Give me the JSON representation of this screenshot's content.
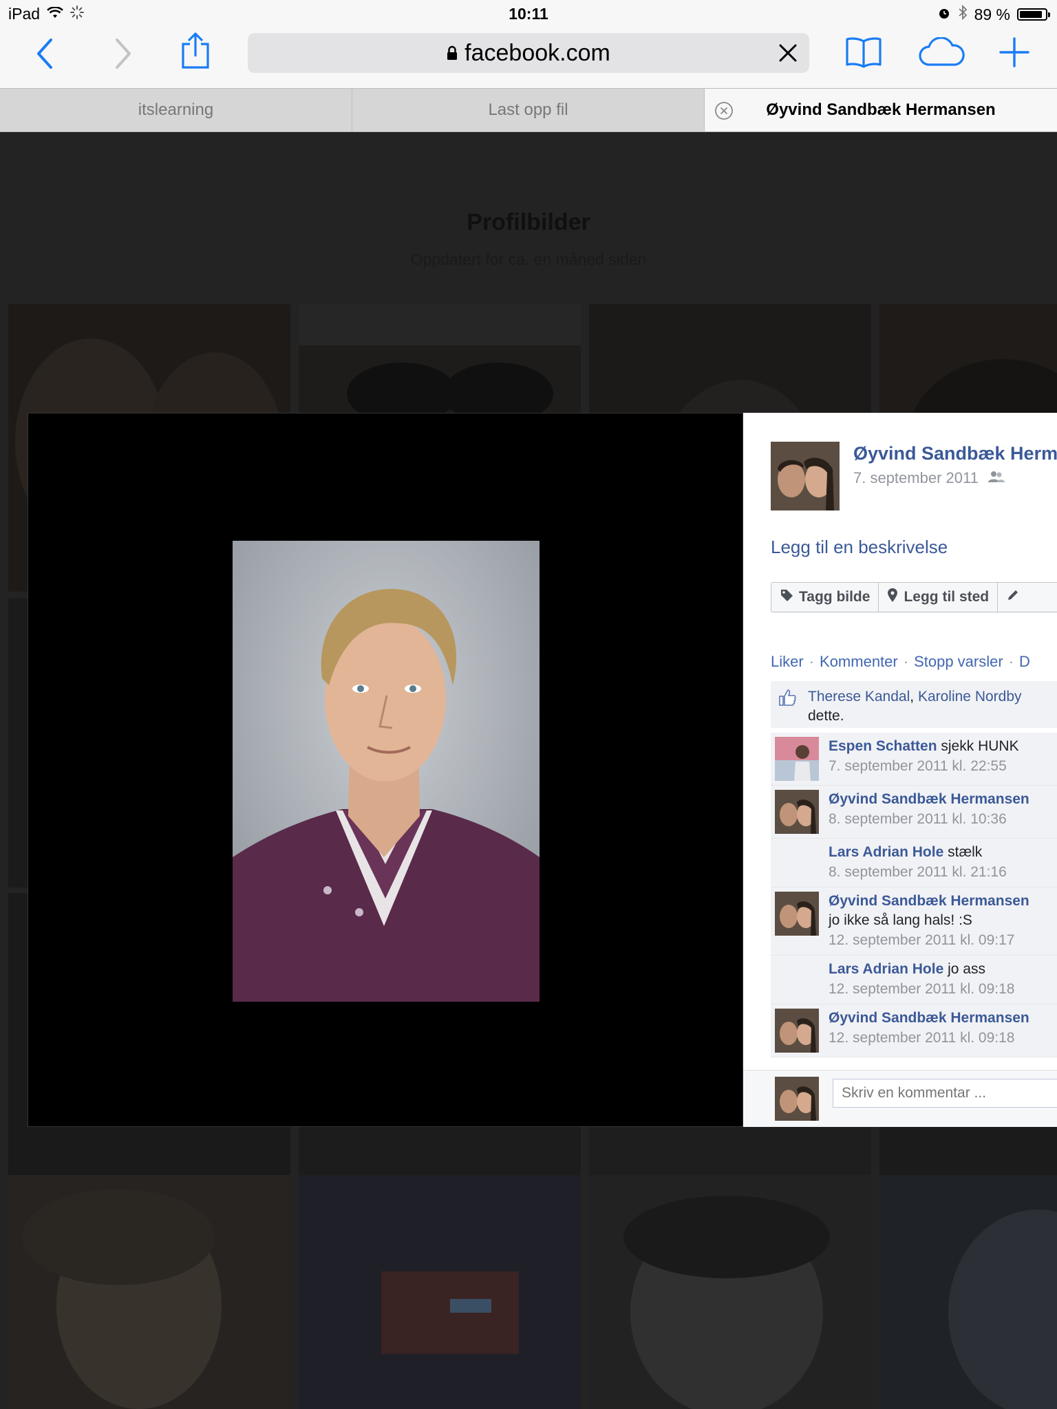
{
  "status_bar": {
    "device": "iPad",
    "time": "10:11",
    "battery_text": "89 %",
    "battery_level": 0.89
  },
  "browser": {
    "url": "facebook.com",
    "tabs": [
      {
        "label": "itslearning",
        "active": false
      },
      {
        "label": "Last opp fil",
        "active": false
      },
      {
        "label": "Øyvind Sandbæk Hermansen",
        "active": true
      }
    ],
    "accent_color": "#1a7cf5"
  },
  "album": {
    "title": "Profilbilder",
    "subtitle": "Oppdatert for ca. en måned siden"
  },
  "photo_panel": {
    "owner_name": "Øyvind Sandbæk Hermansen",
    "owner_date": "7. september 2011",
    "add_description": "Legg til en beskrivelse",
    "buttons": {
      "tag": "Tagg bilde",
      "location": "Legg til sted"
    },
    "actions": {
      "like": "Liker",
      "comment": "Kommenter",
      "stop_notifications": "Stopp varsler",
      "more": "D"
    },
    "likes": {
      "person1": "Therese Kandal",
      "separator": ", ",
      "person2": "Karoline Nordby",
      "suffix": "dette."
    },
    "comments": [
      {
        "author": "Espen Schatten",
        "text": "sjekk HUNK",
        "time": "7. september 2011 kl. 22:55",
        "avatar": "espen"
      },
      {
        "author": "Øyvind Sandbæk Hermansen",
        "text": "",
        "time": "8. september 2011 kl. 10:36",
        "avatar": "couple"
      },
      {
        "author": "Lars Adrian Hole",
        "text": "stælk",
        "time": "8. september 2011 kl. 21:16",
        "avatar": "none"
      },
      {
        "author": "Øyvind Sandbæk Hermansen",
        "text": "jo ikke så lang hals! :S",
        "time": "12. september 2011 kl. 09:17",
        "avatar": "couple"
      },
      {
        "author": "Lars Adrian Hole",
        "text": "jo ass",
        "time": "12. september 2011 kl. 09:18",
        "avatar": "none"
      },
      {
        "author": "Øyvind Sandbæk Hermansen",
        "text": "",
        "time": "12. september 2011 kl. 09:18",
        "avatar": "couple"
      }
    ],
    "composer_placeholder": "Skriv en kommentar ...",
    "link_color": "#3b5998"
  }
}
